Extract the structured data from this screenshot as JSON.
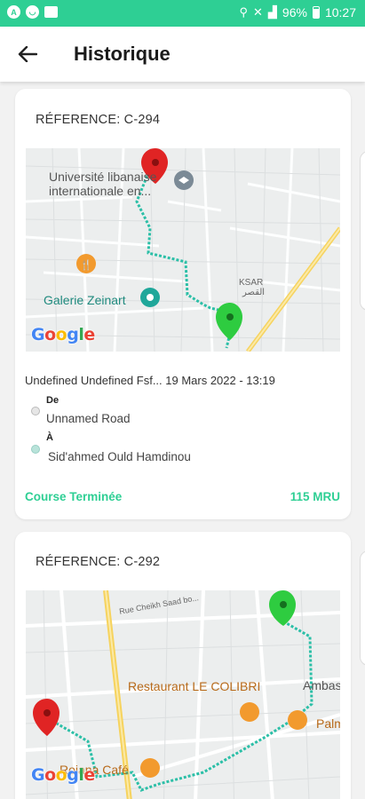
{
  "status_bar": {
    "left_icons": [
      "app-icon",
      "face-icon",
      "message-icon"
    ],
    "right_icons": [
      "location-icon",
      "wifi-off-icon",
      "signal-icon"
    ],
    "battery": "96%",
    "time": "10:27"
  },
  "header": {
    "title": "Historique",
    "back_icon": "arrow-left-icon"
  },
  "rides": [
    {
      "reference": "RÉFERENCE: C-294",
      "map": {
        "labels": {
          "university": "Université libanaise internationale en...",
          "galerie": "Galerie Zeinart",
          "ksar": "KSAR",
          "ksar_ar": "القصر"
        },
        "logo": "Google"
      },
      "driver_date": "Undefined Undefined Fsf... 19 Mars 2022 - 13:19",
      "from_label": "De",
      "from_address": "Unnamed Road",
      "to_label": "À",
      "to_address": "Sid'ahmed Ould Hamdinou",
      "status": "Course Terminée",
      "price": "115 MRU"
    },
    {
      "reference": "RÉFERENCE: C-292",
      "map": {
        "labels": {
          "street": "Rue Cheikh Saad bo...",
          "restaurant": "Restaurant LE COLIBRI",
          "ambassade": "Ambassad",
          "palm": "Palm",
          "rojana": "Rojana Café"
        },
        "logo": "Google"
      }
    }
  ],
  "colors": {
    "accent": "#2ecf94",
    "route": "#2bbfa7",
    "pin_start": "#2ecc40",
    "pin_end": "#e02424"
  }
}
